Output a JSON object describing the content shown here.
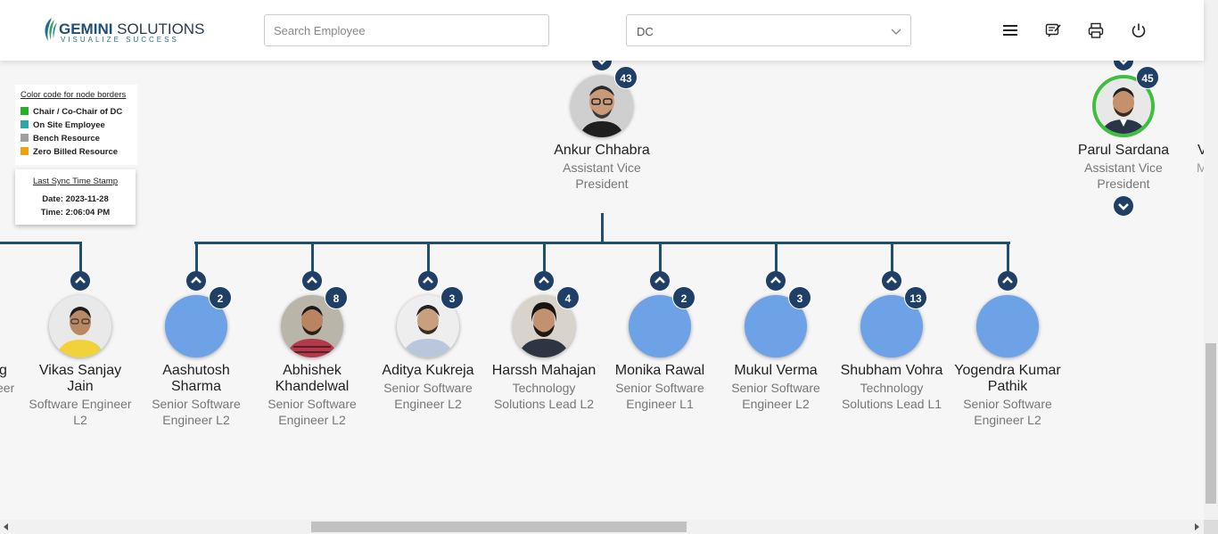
{
  "header": {
    "logo_name_bold": "GEMINI",
    "logo_name_rest": " SOLUTIONS",
    "logo_tagline": "VISUALIZE SUCCESS",
    "search_placeholder": "Search Employee",
    "dc_select_value": "DC",
    "icons": [
      "menu-icon",
      "feedback-icon",
      "print-icon",
      "power-icon"
    ]
  },
  "legend": {
    "title": "Color code for node borders",
    "items": [
      {
        "label": "Chair / Co-Chair of DC",
        "color": "#22b222"
      },
      {
        "label": "On Site Employee",
        "color": "#2aa8a8"
      },
      {
        "label": "Bench Resource",
        "color": "#a0a0a0"
      },
      {
        "label": "Zero Billed Resource",
        "color": "#f0a010"
      }
    ]
  },
  "sync": {
    "title": "Last Sync Time Stamp",
    "date": "Date: 2023-11-28",
    "time": "Time: 2:06:04 PM"
  },
  "top_nodes": [
    {
      "name": "Ankur Chhabra",
      "role_line1": "Assistant Vice",
      "role_line2": "President",
      "count": "43"
    },
    {
      "name": "Parul Sardana",
      "role_line1": "Assistant Vice",
      "role_line2": "President",
      "count": "45"
    }
  ],
  "partial_texts": {
    "left_name": "g",
    "left_role": "eer",
    "right_name": "V",
    "right_role": "M"
  },
  "children": [
    {
      "name1": "Vikas Sanjay",
      "name2": "Jain",
      "role1": "Software Engineer",
      "role2": "L2",
      "count": ""
    },
    {
      "name1": "Aashutosh",
      "name2": "Sharma",
      "role1": "Senior Software",
      "role2": "Engineer L2",
      "count": "2"
    },
    {
      "name1": "Abhishek",
      "name2": "Khandelwal",
      "role1": "Senior Software",
      "role2": "Engineer L2",
      "count": "8"
    },
    {
      "name1": "Aditya Kukreja",
      "name2": "",
      "role1": "Senior Software",
      "role2": "Engineer L2",
      "count": "3"
    },
    {
      "name1": "Harssh Mahajan",
      "name2": "",
      "role1": "Technology",
      "role2": "Solutions Lead L2",
      "count": "4"
    },
    {
      "name1": "Monika Rawal",
      "name2": "",
      "role1": "Senior Software",
      "role2": "Engineer L1",
      "count": "2"
    },
    {
      "name1": "Mukul Verma",
      "name2": "",
      "role1": "Senior Software",
      "role2": "Engineer L2",
      "count": "3"
    },
    {
      "name1": "Shubham Vohra",
      "name2": "",
      "role1": "Technology",
      "role2": "Solutions Lead L1",
      "count": "13"
    },
    {
      "name1": "Yogendra Kumar",
      "name2": "Pathik",
      "role1": "Senior Software",
      "role2": "Engineer L2",
      "count": ""
    }
  ]
}
